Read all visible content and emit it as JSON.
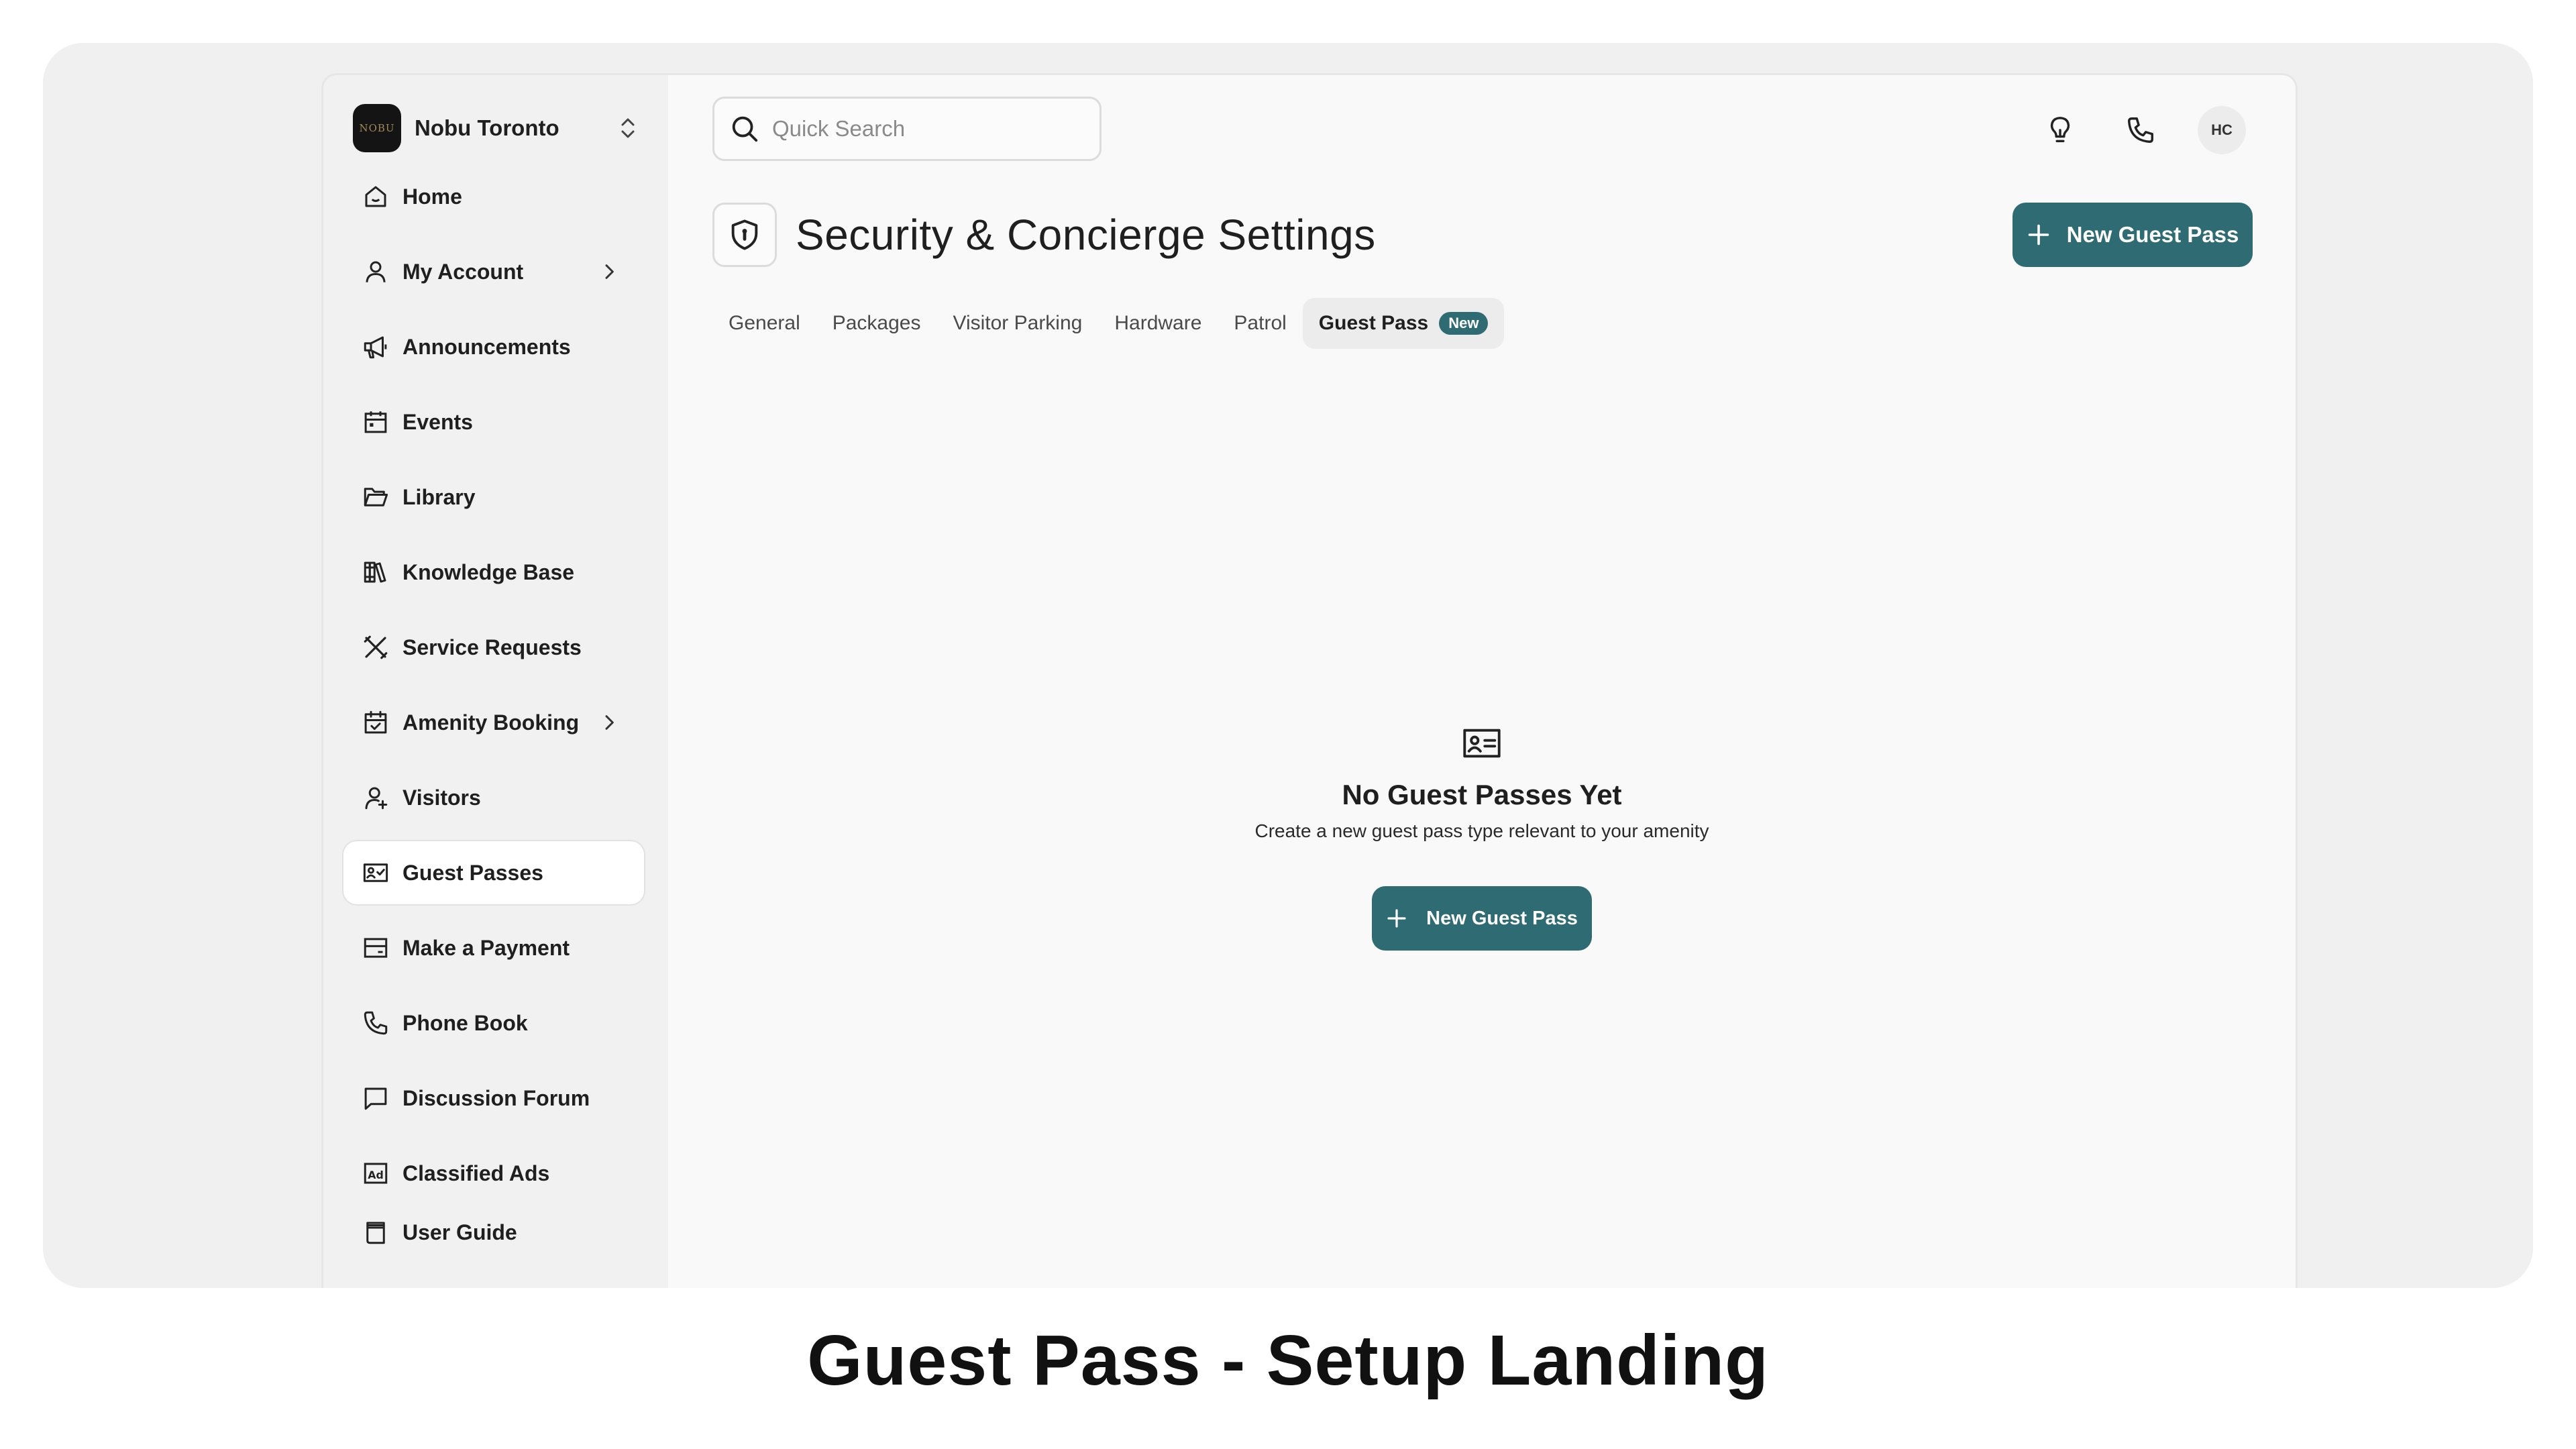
{
  "org": {
    "name": "Nobu Toronto",
    "logo_text": "NOBU"
  },
  "sidebar": {
    "items": [
      {
        "label": "Home",
        "icon": "home-icon"
      },
      {
        "label": "My Account",
        "icon": "user-icon",
        "has_submenu": true
      },
      {
        "label": "Announcements",
        "icon": "megaphone-icon"
      },
      {
        "label": "Events",
        "icon": "calendar-icon"
      },
      {
        "label": "Library",
        "icon": "folder-icon"
      },
      {
        "label": "Knowledge Base",
        "icon": "books-icon"
      },
      {
        "label": "Service Requests",
        "icon": "tools-icon"
      },
      {
        "label": "Amenity Booking",
        "icon": "calendar-check-icon",
        "has_submenu": true
      },
      {
        "label": "Visitors",
        "icon": "user-plus-icon"
      },
      {
        "label": "Guest Passes",
        "icon": "id-card-icon",
        "active": true
      },
      {
        "label": "Make a Payment",
        "icon": "credit-card-icon"
      },
      {
        "label": "Phone Book",
        "icon": "phone-icon"
      },
      {
        "label": "Discussion Forum",
        "icon": "chat-bubble-icon"
      },
      {
        "label": "Classified Ads",
        "icon": "ad-icon"
      },
      {
        "label": "User Guide",
        "icon": "book-icon"
      }
    ]
  },
  "header": {
    "search_placeholder": "Quick Search",
    "avatar_initials": "HC"
  },
  "page": {
    "title": "Security & Concierge Settings",
    "new_button_label": "New Guest Pass"
  },
  "tabs": [
    {
      "label": "General"
    },
    {
      "label": "Packages"
    },
    {
      "label": "Visitor Parking"
    },
    {
      "label": "Hardware"
    },
    {
      "label": "Patrol"
    },
    {
      "label": "Guest Pass",
      "badge": "New",
      "active": true
    }
  ],
  "empty_state": {
    "title": "No Guest Passes Yet",
    "subtitle": "Create a new guest pass type relevant to your amenity",
    "button_label": "New Guest Pass"
  },
  "caption": "Guest Pass - Setup Landing",
  "colors": {
    "accent": "#2f6b73",
    "sidebar_bg": "#f1f1f1",
    "content_bg": "#f9f9f9"
  }
}
